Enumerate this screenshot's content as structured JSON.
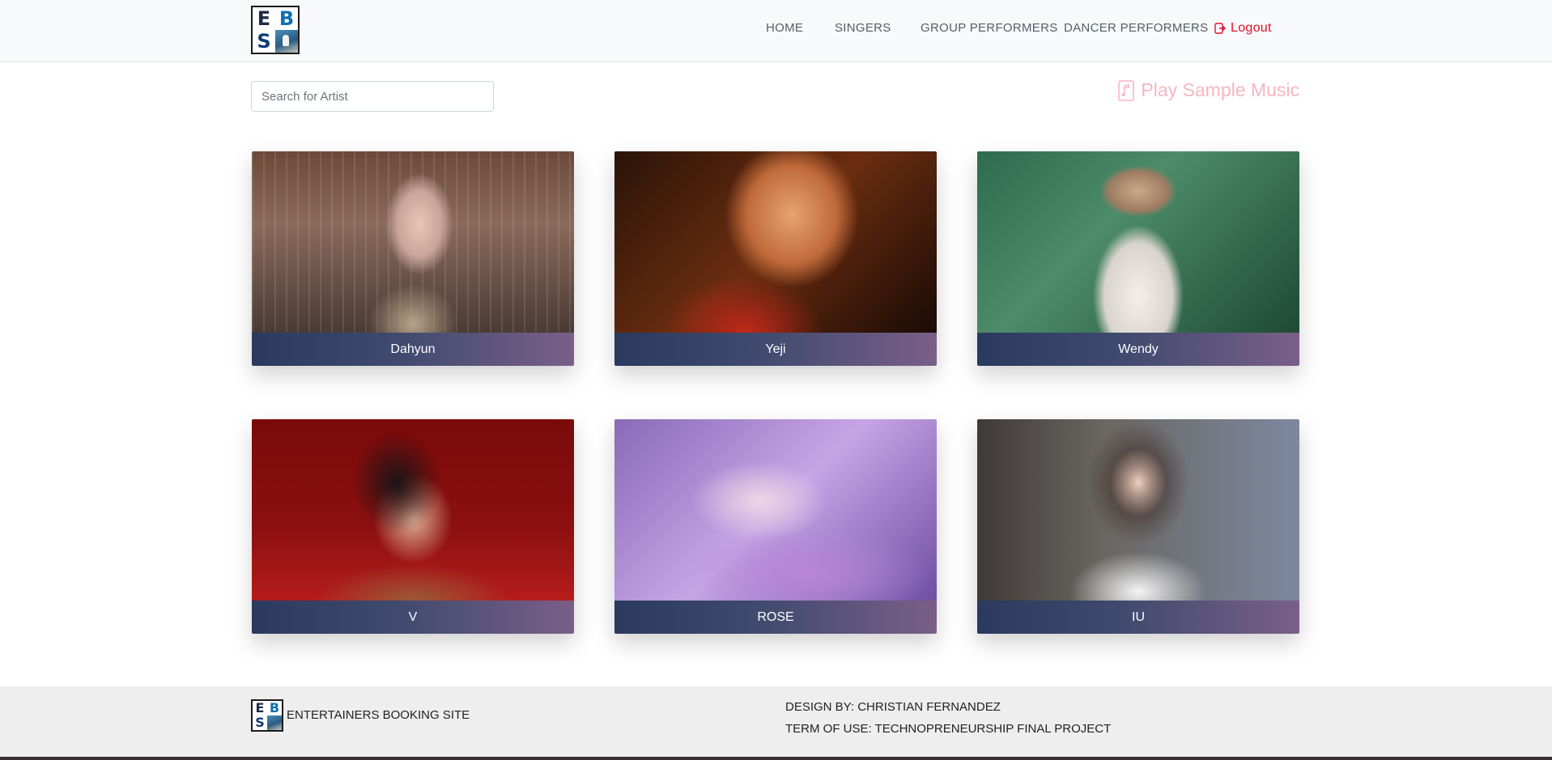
{
  "brand": {
    "logo_letters": [
      "E",
      "B",
      "S"
    ],
    "logo_icon": "performer-photo-icon"
  },
  "nav": {
    "home": "HOME",
    "singers": "SINGERS",
    "group_performers": "GROUP PERFORMERS",
    "dancer_performers": "DANCER PERFORMERS",
    "logout": "Logout",
    "logout_icon": "logout-icon",
    "logout_color": "#e0112b"
  },
  "search": {
    "placeholder": "Search for Artist",
    "value": ""
  },
  "music": {
    "label": "Play Sample Music",
    "icon": "music-note-icon",
    "color": "#f8b4c4"
  },
  "artists": [
    {
      "name": "Dahyun"
    },
    {
      "name": "Yeji"
    },
    {
      "name": "Wendy"
    },
    {
      "name": "V"
    },
    {
      "name": "ROSE"
    },
    {
      "name": "IU"
    }
  ],
  "footer": {
    "brand": "ENTERTAINERS BOOKING SITE",
    "design_by": "DESIGN BY: CHRISTIAN FERNANDEZ",
    "terms": "TERM OF USE: TECHNOPRENEURSHIP FINAL PROJECT"
  }
}
